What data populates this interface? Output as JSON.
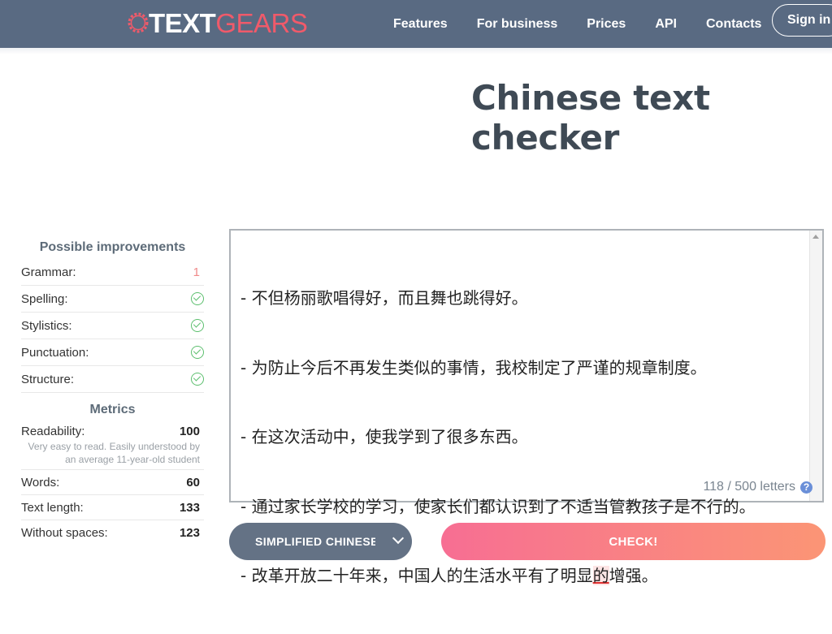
{
  "header": {
    "logo_part1": "TEXT",
    "logo_part2": "GEARS",
    "nav": [
      "Features",
      "For business",
      "Prices",
      "API",
      "Contacts"
    ],
    "signin_label": "Sign in"
  },
  "page_title": "Chinese text checker",
  "sidebar": {
    "improvements_heading": "Possible improvements",
    "improvements": [
      {
        "label": "Grammar:",
        "value": "1",
        "status": "error"
      },
      {
        "label": "Spelling:",
        "status": "ok",
        "icon": "check-circle-icon"
      },
      {
        "label": "Stylistics:",
        "status": "ok",
        "icon": "check-circle-icon"
      },
      {
        "label": "Punctuation:",
        "status": "ok",
        "icon": "check-circle-icon"
      },
      {
        "label": "Structure:",
        "status": "ok",
        "icon": "check-circle-icon"
      }
    ],
    "metrics_heading": "Metrics",
    "metrics": {
      "readability": {
        "label": "Readability:",
        "value": "100",
        "note": "Very easy to read. Easily understood by an average 11-year-old student"
      },
      "words": {
        "label": "Words:",
        "value": "60"
      },
      "text_length": {
        "label": "Text length:",
        "value": "133"
      },
      "without_spaces": {
        "label": "Without spaces:",
        "value": "123"
      }
    }
  },
  "editor": {
    "lines": [
      "- 不但杨丽歌唱得好，而且舞也跳得好。",
      "- 为防止今后不再发生类似的事情，我校制定了严谨的规章制度。",
      "- 在这次活动中，使我学到了很多东西。",
      "- 通过家长学校的学习，使家长们都认识到了不适当管教孩子是不行的。"
    ],
    "last_line_before": "- 改革开放二十年来，中国人的生活水平有了明显",
    "last_line_error": "的",
    "last_line_after": "增强。",
    "counter": "118 / 500 letters"
  },
  "language_select": {
    "selected": "SIMPLIFIED CHINESE"
  },
  "check_button": "CHECK!",
  "colors": {
    "header_bg": "#596a82",
    "accent_red": "#f05a6a",
    "ok_green": "#5cbf6e",
    "select_bg": "#647285",
    "check_gradient_start": "#f76e93",
    "check_gradient_end": "#fb9575"
  }
}
